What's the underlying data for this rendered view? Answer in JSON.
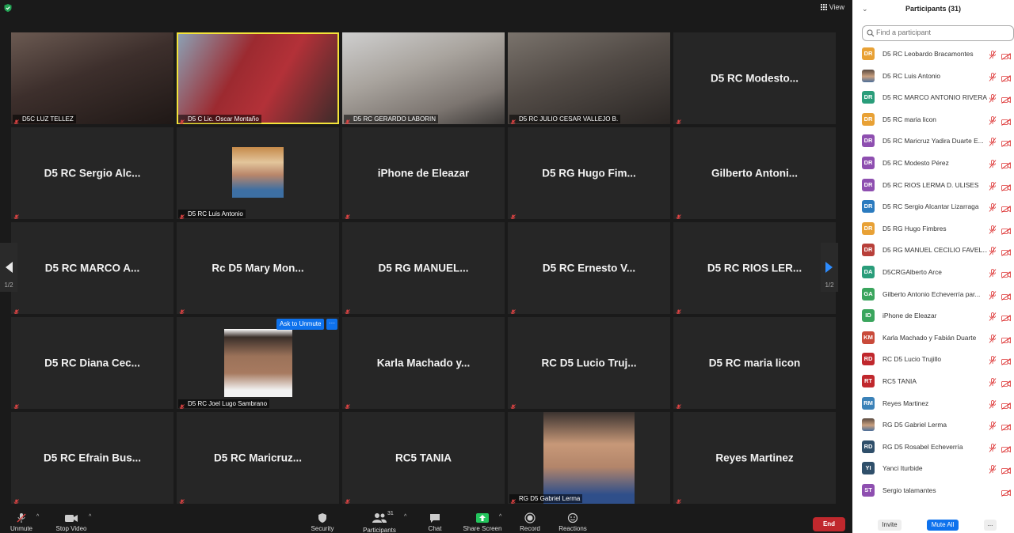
{
  "view_label": "View",
  "tiles": [
    {
      "label": "D5C LUZ TELLEZ",
      "bigname": "",
      "video": true
    },
    {
      "label": "D5 C Lic. Oscar Montaño",
      "bigname": "",
      "video": true,
      "active": true
    },
    {
      "label": "D5 RC GERARDO LABORIN",
      "bigname": "",
      "video": true
    },
    {
      "label": "D5 RC JULIO CESAR VALLEJO B.",
      "bigname": "",
      "video": true
    },
    {
      "label": "",
      "bigname": "D5 RC Modesto..."
    },
    {
      "label": "",
      "bigname": "D5 RC Sergio Alc..."
    },
    {
      "label": "D5 RC Luis Antonio",
      "bigname": "",
      "photo": true
    },
    {
      "label": "",
      "bigname": "iPhone de Eleazar"
    },
    {
      "label": "",
      "bigname": "D5 RG Hugo Fim..."
    },
    {
      "label": "",
      "bigname": "Gilberto Antoni..."
    },
    {
      "label": "",
      "bigname": "D5 RC MARCO A..."
    },
    {
      "label": "",
      "bigname": "Rc D5 Mary Mon..."
    },
    {
      "label": "",
      "bigname": "D5 RG MANUEL..."
    },
    {
      "label": "",
      "bigname": "D5 RC Ernesto V..."
    },
    {
      "label": "",
      "bigname": "D5 RC RIOS LER..."
    },
    {
      "label": "",
      "bigname": "D5 RC Diana Cec..."
    },
    {
      "label": "D5 RC Joel Lugo Sambrano",
      "bigname": "",
      "photo": true
    },
    {
      "label": "",
      "bigname": "Karla Machado y..."
    },
    {
      "label": "",
      "bigname": "RC D5 Lucio Truj..."
    },
    {
      "label": "",
      "bigname": "D5 RC maria licon"
    },
    {
      "label": "",
      "bigname": "D5 RC Efrain Bus..."
    },
    {
      "label": "",
      "bigname": "D5 RC Maricruz..."
    },
    {
      "label": "",
      "bigname": "RC5 TANIA"
    },
    {
      "label": "RG D5 Gabriel Lerma",
      "bigname": "",
      "video": true
    },
    {
      "label": "",
      "bigname": "Reyes Martinez"
    }
  ],
  "pager": {
    "left": "1/2",
    "right": "1/2"
  },
  "ask_unmute": "Ask to Unmute",
  "ask_more": "···",
  "toolbar": {
    "unmute": "Unmute",
    "stop_video": "Stop Video",
    "security": "Security",
    "participants": "Participants",
    "participants_count": "31",
    "chat": "Chat",
    "share_screen": "Share Screen",
    "record": "Record",
    "reactions": "Reactions",
    "end": "End"
  },
  "panel": {
    "title": "Participants (31)",
    "search_placeholder": "Find a participant",
    "invite": "Invite",
    "mute_all": "Mute All",
    "more": "..."
  },
  "participants": [
    {
      "initials": "DR",
      "color": "#e8a135",
      "name": "D5 RC Leobardo Bracamontes"
    },
    {
      "initials": "",
      "color": "#8a7a6a",
      "name": "D5 RC Luis Antonio",
      "photo": true
    },
    {
      "initials": "DR",
      "color": "#2a9d7a",
      "name": "D5 RC MARCO ANTONIO RIVERA"
    },
    {
      "initials": "DR",
      "color": "#e8a135",
      "name": "D5 RC maria licon"
    },
    {
      "initials": "DR",
      "color": "#8e4fb0",
      "name": "D5 RC Maricruz Yadira Duarte E..."
    },
    {
      "initials": "DR",
      "color": "#8e4fb0",
      "name": "D5 RC Modesto Pérez"
    },
    {
      "initials": "DR",
      "color": "#8e4fb0",
      "name": "D5 RC RIOS LERMA D. ULISES"
    },
    {
      "initials": "DR",
      "color": "#2b7bbf",
      "name": "D5 RC Sergio Alcantar Lizarraga"
    },
    {
      "initials": "DR",
      "color": "#e8a135",
      "name": "D5 RG Hugo Fimbres"
    },
    {
      "initials": "DR",
      "color": "#b8403a",
      "name": "D5 RG MANUEL CECILIO FAVEL..."
    },
    {
      "initials": "DA",
      "color": "#2a9d7a",
      "name": "D5CRGAlberto Arce"
    },
    {
      "initials": "GA",
      "color": "#3aa55d",
      "name": "Gilberto Antonio Echeverría par..."
    },
    {
      "initials": "ID",
      "color": "#3aa55d",
      "name": "iPhone de Eleazar"
    },
    {
      "initials": "KM",
      "color": "#c94a3a",
      "name": "Karla Machado y Fabián Duarte"
    },
    {
      "initials": "RD",
      "color": "#c0282d",
      "name": "RC D5 Lucio Trujillo"
    },
    {
      "initials": "RT",
      "color": "#c0282d",
      "name": "RC5 TANIA"
    },
    {
      "initials": "RM",
      "color": "#3b82b8",
      "name": "Reyes Martinez"
    },
    {
      "initials": "",
      "color": "#8a7a6a",
      "name": "RG D5 Gabriel Lerma",
      "photo": true
    },
    {
      "initials": "RD",
      "color": "#2f4f6a",
      "name": "RG D5 Rosabel Echeverría"
    },
    {
      "initials": "YI",
      "color": "#2f4f6a",
      "name": "Yanci Iturbide"
    },
    {
      "initials": "ST",
      "color": "#8e4fb0",
      "name": "Sergio talamantes",
      "no_mic": true
    }
  ]
}
